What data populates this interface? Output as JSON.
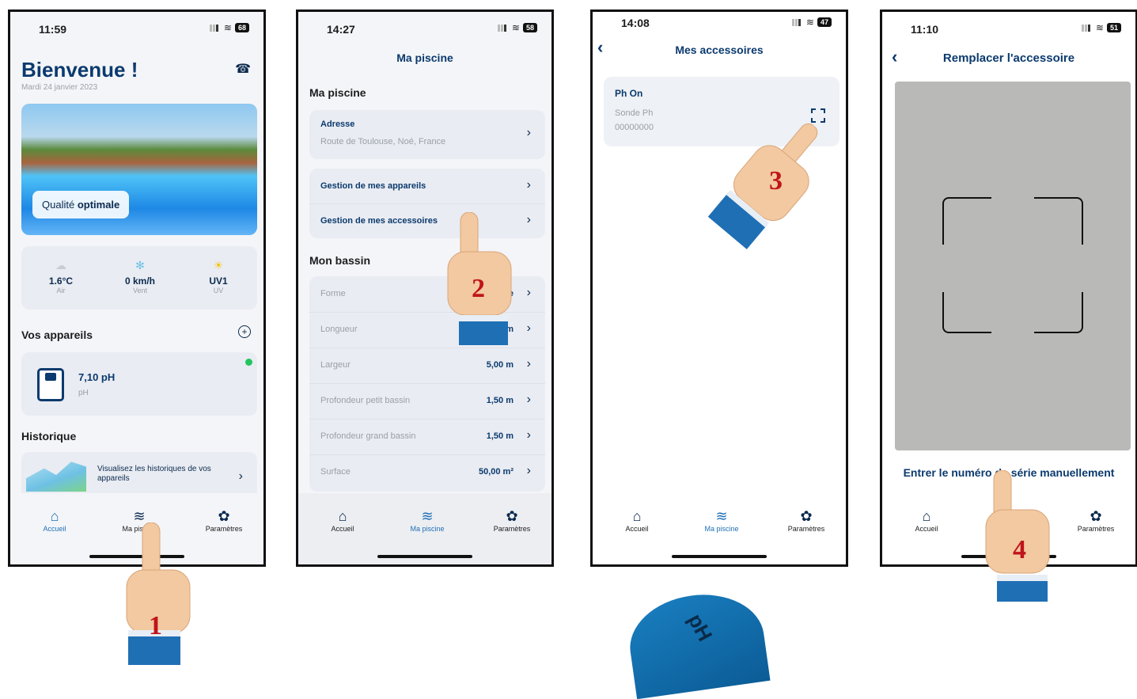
{
  "screen1": {
    "time": "11:59",
    "battery": "68",
    "greeting": "Bienvenue !",
    "date": "Mardi 24 janvier 2023",
    "quality_prefix": "Qualité ",
    "quality_value": "optimale",
    "weather": [
      {
        "value": "1.6°C",
        "label": "Air",
        "icon": "cloud-icon"
      },
      {
        "value": "0 km/h",
        "label": "Vent",
        "icon": "wind-icon"
      },
      {
        "value": "UV1",
        "label": "UV",
        "icon": "sun-icon"
      }
    ],
    "devices_title": "Vos appareils",
    "device_value": "7,10 pH",
    "device_unit": "pH",
    "history_title": "Historique",
    "history_text": "Visualisez les historiques de vos appareils"
  },
  "screen2": {
    "time": "14:27",
    "battery": "58",
    "title": "Ma piscine",
    "section1": "Ma piscine",
    "address_label": "Adresse",
    "address_value": "Route de Toulouse, Noé, France",
    "manage_devices": "Gestion de mes appareils",
    "manage_accessories": "Gestion de mes accessoires",
    "section2": "Mon bassin",
    "rows": [
      {
        "label": "Forme",
        "value": "ire"
      },
      {
        "label": "Longueur",
        "value": "m"
      },
      {
        "label": "Largeur",
        "value": "5,00 m"
      },
      {
        "label": "Profondeur petit bassin",
        "value": "1,50 m"
      },
      {
        "label": "Profondeur grand bassin",
        "value": "1,50 m"
      },
      {
        "label": "Surface",
        "value": "50,00 m²"
      }
    ]
  },
  "screen3": {
    "time": "14:08",
    "battery": "47",
    "title": "Mes accessoires",
    "accessory_name": "Ph On",
    "accessory_type": "Sonde Ph",
    "accessory_serial": "00000000"
  },
  "screen4": {
    "time": "11:10",
    "battery": "51",
    "title": "Remplacer l'accessoire",
    "manual_entry": "Entrer le numéro de série manuellement"
  },
  "tabs": {
    "home": "Accueil",
    "pool": "Ma piscine",
    "settings": "Paramètres"
  },
  "steps": [
    "1",
    "2",
    "3",
    "4"
  ],
  "badge_text": "pH",
  "colors": {
    "brand_dark": "#0b2a4e",
    "brand_blue": "#1f6fb5",
    "status_green": "#22c55e",
    "step_red": "#c0141b"
  }
}
